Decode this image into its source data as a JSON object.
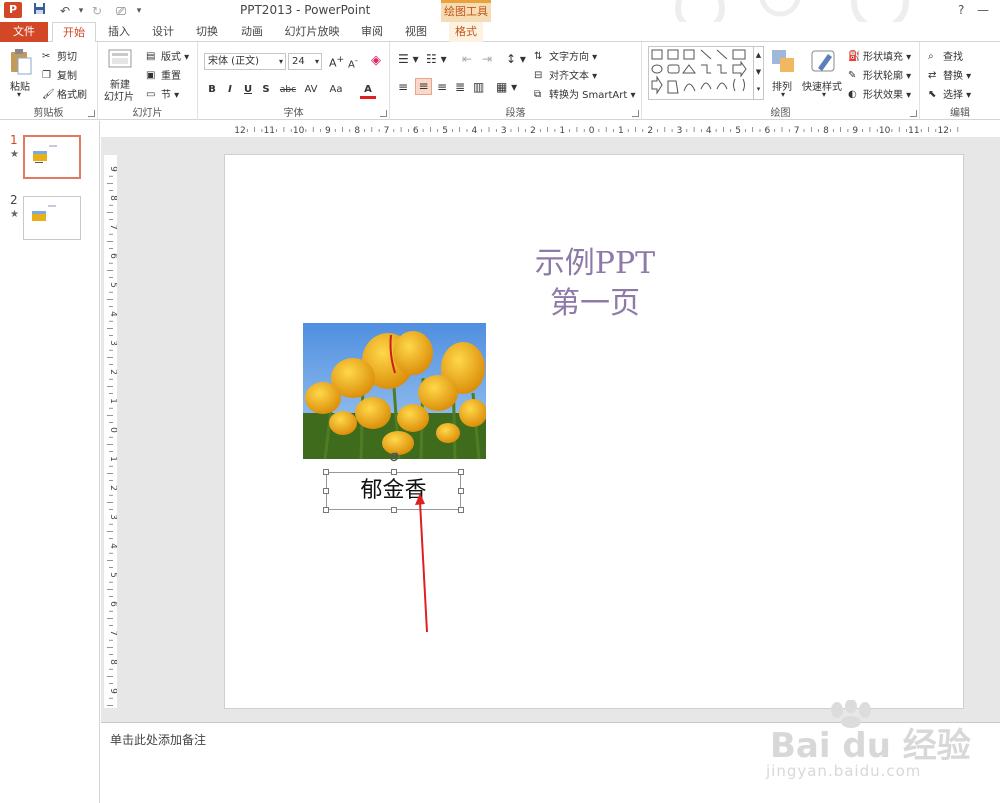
{
  "window": {
    "title": "PPT2013 - PowerPoint",
    "context_group": "绘图工具",
    "help": "?",
    "minimize": "—"
  },
  "tabs": [
    "文件",
    "开始",
    "插入",
    "设计",
    "切换",
    "动画",
    "幻灯片放映",
    "审阅",
    "视图",
    "格式"
  ],
  "ribbon": {
    "clipboard": {
      "label": "剪贴板",
      "paste": "粘贴",
      "cut": "剪切",
      "copy": "复制",
      "painter": "格式刷"
    },
    "slides": {
      "label": "幻灯片",
      "new_slide_l1": "新建",
      "new_slide_l2": "幻灯片",
      "layout": "版式",
      "reset": "重置",
      "section": "节"
    },
    "font": {
      "label": "字体",
      "font_name": "宋体 (正文)",
      "font_size": "24",
      "bold": "B",
      "italic": "I",
      "underline": "U",
      "shadow": "S",
      "strike": "abc",
      "spacing": "AV",
      "case": "Aa",
      "color": "A"
    },
    "paragraph": {
      "label": "段落",
      "text_direction": "文字方向",
      "align_text": "对齐文本",
      "smartart": "转换为 SmartArt"
    },
    "drawing": {
      "label": "绘图",
      "arrange": "排列",
      "quick_styles": "快速样式",
      "fill": "形状填充",
      "outline": "形状轮廓",
      "effects": "形状效果"
    },
    "editing": {
      "label": "编辑",
      "find": "查找",
      "replace": "替换",
      "select": "选择"
    }
  },
  "thumbnails": [
    {
      "number": "1",
      "star": "★"
    },
    {
      "number": "2",
      "star": "★"
    }
  ],
  "hruler_labels": [
    "12",
    "11",
    "10",
    "9",
    "8",
    "7",
    "6",
    "5",
    "4",
    "3",
    "2",
    "1",
    "0",
    "1",
    "2",
    "3",
    "4",
    "5",
    "6",
    "7",
    "8",
    "9",
    "10",
    "11",
    "12"
  ],
  "vruler_labels": [
    "9",
    "8",
    "7",
    "6",
    "5",
    "4",
    "3",
    "2",
    "1",
    "0",
    "1",
    "2",
    "3",
    "4",
    "5",
    "6",
    "7",
    "8",
    "9"
  ],
  "slide": {
    "title_line1": "示例PPT",
    "title_line2": "第一页",
    "caption": "郁金香"
  },
  "notes": {
    "placeholder": "单击此处添加备注"
  },
  "watermark": {
    "logo": "Bai du 经验",
    "url": "jingyan.baidu.com"
  }
}
